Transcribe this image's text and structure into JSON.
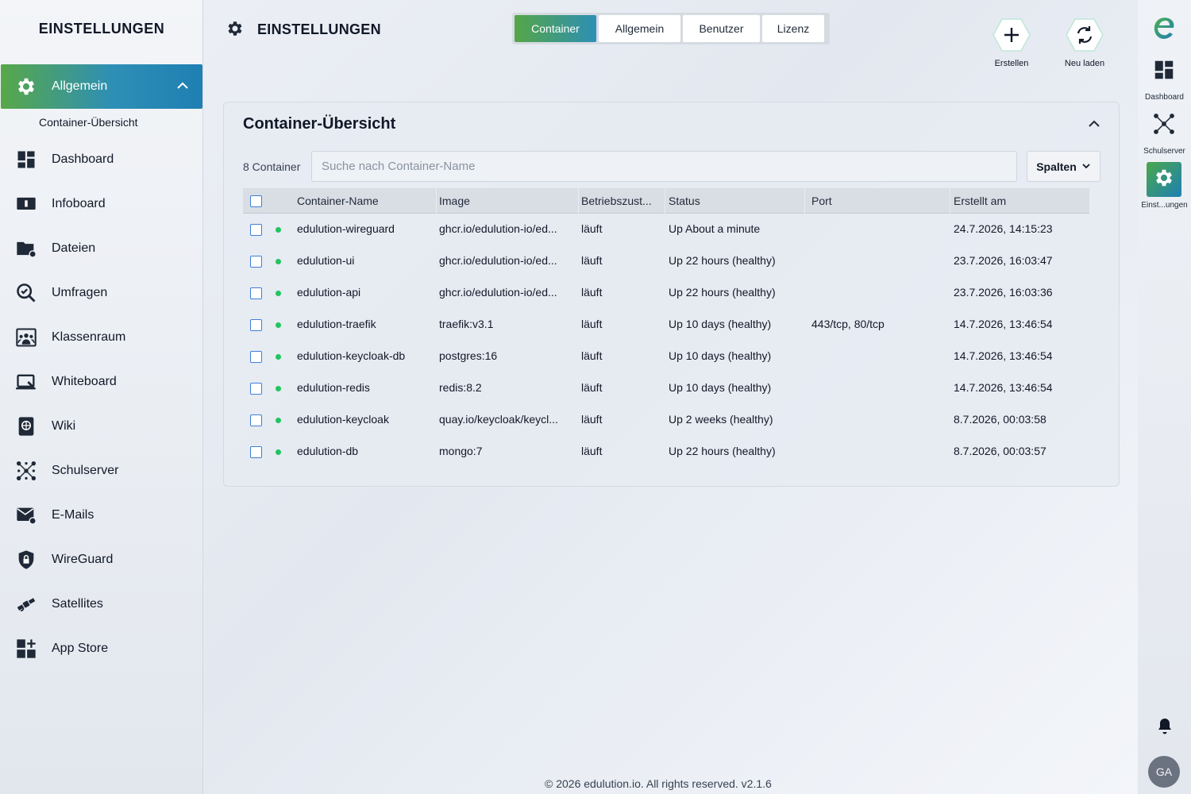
{
  "sidebar": {
    "title": "EINSTELLUNGEN",
    "active_item": "Allgemein",
    "sub_item": "Container-Übersicht",
    "items": [
      {
        "label": "Dashboard",
        "icon": "dashboard-icon"
      },
      {
        "label": "Infoboard",
        "icon": "infoboard-icon"
      },
      {
        "label": "Dateien",
        "icon": "folder-icon"
      },
      {
        "label": "Umfragen",
        "icon": "survey-icon"
      },
      {
        "label": "Klassenraum",
        "icon": "classroom-icon"
      },
      {
        "label": "Whiteboard",
        "icon": "whiteboard-icon"
      },
      {
        "label": "Wiki",
        "icon": "wiki-icon"
      },
      {
        "label": "Schulserver",
        "icon": "network-icon"
      },
      {
        "label": "E-Mails",
        "icon": "mail-icon"
      },
      {
        "label": "WireGuard",
        "icon": "shield-lock-icon"
      },
      {
        "label": "Satellites",
        "icon": "satellite-icon"
      },
      {
        "label": "App Store",
        "icon": "app-store-icon"
      }
    ]
  },
  "header": {
    "title": "EINSTELLUNGEN",
    "tabs": [
      "Container",
      "Allgemein",
      "Benutzer",
      "Lizenz"
    ],
    "active_tab": "Container",
    "actions": [
      {
        "label": "Erstellen",
        "icon": "plus-icon"
      },
      {
        "label": "Neu laden",
        "icon": "reload-icon"
      }
    ]
  },
  "card": {
    "title": "Container-Übersicht",
    "count": "8 Container",
    "search_placeholder": "Suche nach Container-Name",
    "columns_button": "Spalten",
    "columns": [
      "Container-Name",
      "Image",
      "Betriebszust...",
      "Status",
      "Port",
      "Erstellt am"
    ],
    "rows": [
      {
        "name": "edulution-wireguard",
        "image": "ghcr.io/edulution-io/ed...",
        "state": "läuft",
        "status": "Up About a minute",
        "port": "",
        "created": "24.7.2026, 14:15:23"
      },
      {
        "name": "edulution-ui",
        "image": "ghcr.io/edulution-io/ed...",
        "state": "läuft",
        "status": "Up 22 hours (healthy)",
        "port": "",
        "created": "23.7.2026, 16:03:47"
      },
      {
        "name": "edulution-api",
        "image": "ghcr.io/edulution-io/ed...",
        "state": "läuft",
        "status": "Up 22 hours (healthy)",
        "port": "",
        "created": "23.7.2026, 16:03:36"
      },
      {
        "name": "edulution-traefik",
        "image": "traefik:v3.1",
        "state": "läuft",
        "status": "Up 10 days (healthy)",
        "port": "443/tcp, 80/tcp",
        "created": "14.7.2026, 13:46:54"
      },
      {
        "name": "edulution-keycloak-db",
        "image": "postgres:16",
        "state": "läuft",
        "status": "Up 10 days (healthy)",
        "port": "",
        "created": "14.7.2026, 13:46:54"
      },
      {
        "name": "edulution-redis",
        "image": "redis:8.2",
        "state": "läuft",
        "status": "Up 10 days (healthy)",
        "port": "",
        "created": "14.7.2026, 13:46:54"
      },
      {
        "name": "edulution-keycloak",
        "image": "quay.io/keycloak/keycl...",
        "state": "läuft",
        "status": "Up 2 weeks (healthy)",
        "port": "",
        "created": "8.7.2026, 00:03:58"
      },
      {
        "name": "edulution-db",
        "image": "mongo:7",
        "state": "läuft",
        "status": "Up 22 hours (healthy)",
        "port": "",
        "created": "8.7.2026, 00:03:57"
      }
    ]
  },
  "rail": {
    "logo": "e",
    "items": [
      {
        "label": "Dashboard",
        "icon": "dashboard-icon"
      },
      {
        "label": "Schulserver",
        "icon": "network-icon"
      },
      {
        "label": "Einst...ungen",
        "icon": "gear-icon"
      }
    ],
    "avatar": "GA"
  },
  "footer": "© 2026 edulution.io. All rights reserved. v2.1.6",
  "colors": {
    "accent_green": "#58a848",
    "accent_blue": "#1f7fb3",
    "status_running": "#22c55e"
  }
}
